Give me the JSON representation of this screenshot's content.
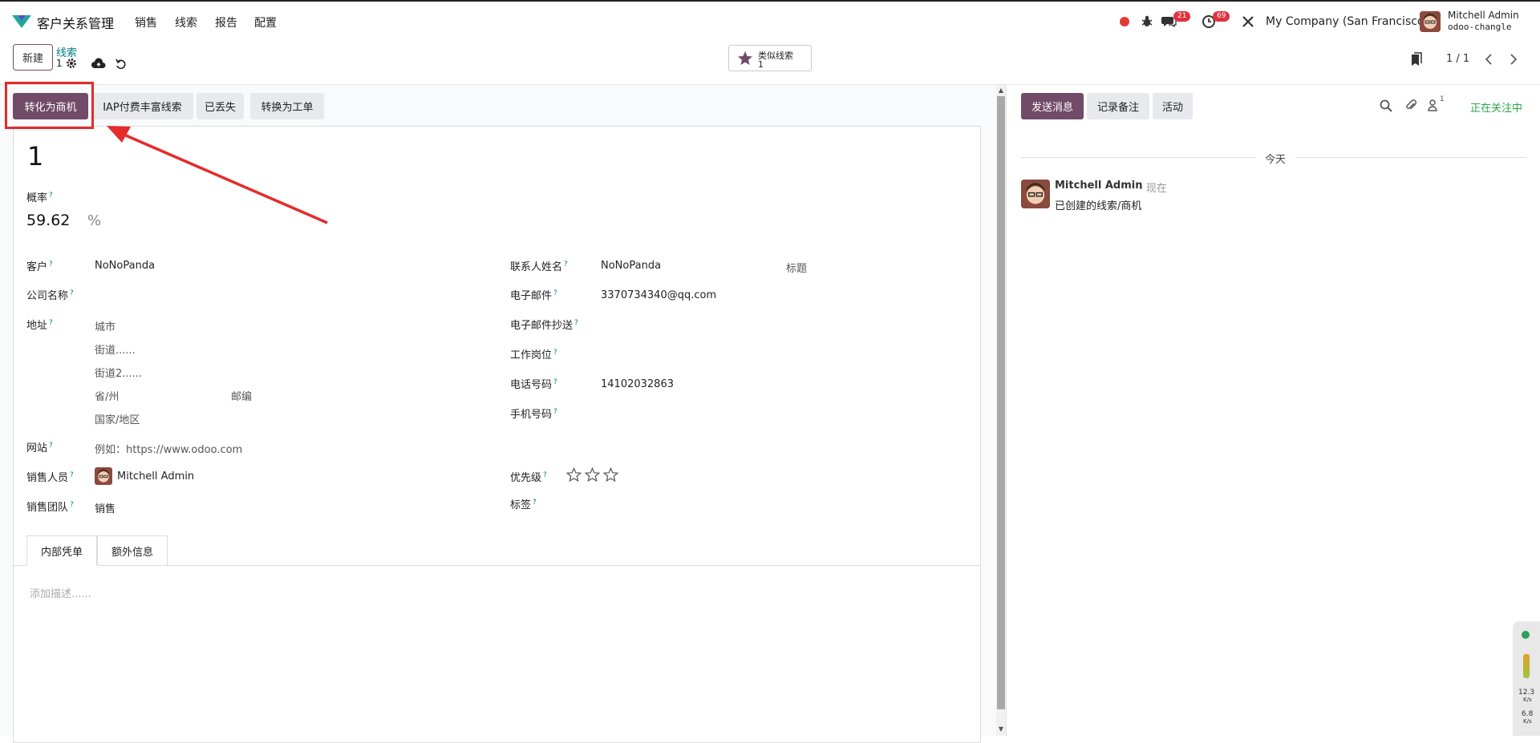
{
  "navbar": {
    "app_title": "客户关系管理",
    "menu": [
      "销售",
      "线索",
      "报告",
      "配置"
    ],
    "messages_badge": "21",
    "activities_badge": "69",
    "company": "My Company (San Francisco)",
    "user_name": "Mitchell Admin",
    "db_name": "odoo-changle"
  },
  "control_panel": {
    "new_label": "新建",
    "breadcrumb_link": "线索",
    "breadcrumb_record": "1",
    "smart_button_label": "类似线索",
    "smart_button_count": "1",
    "pager_value": "1 / 1"
  },
  "status_buttons": [
    "转化为商机",
    "IAP付费丰富线索",
    "已丢失",
    "转换为工单"
  ],
  "form": {
    "record_name": "1",
    "probability_label": "概率",
    "probability_value": "59.62",
    "probability_unit": "%",
    "customer_label": "客户",
    "customer_value": "NoNoPanda",
    "company_label": "公司名称",
    "address_label": "地址",
    "address_city": "城市",
    "address_street": "街道......",
    "address_street2": "街道2......",
    "address_state": "省/州",
    "address_zip": "邮编",
    "address_country": "国家/地区",
    "website_label": "网站",
    "website_placeholder": "例如：https://www.odoo.com",
    "salesperson_label": "销售人员",
    "salesperson_value": "Mitchell Admin",
    "sales_team_label": "销售团队",
    "sales_team_value": "销售",
    "contact_name_label": "联系人姓名",
    "contact_name_value": "NoNoPanda",
    "title_placeholder": "标题",
    "email_label": "电子邮件",
    "email_value": "3370734340@qq.com",
    "email_cc_label": "电子邮件抄送",
    "job_position_label": "工作岗位",
    "phone_label": "电话号码",
    "phone_value": "14102032863",
    "mobile_label": "手机号码",
    "priority_label": "优先级",
    "priority_stars": 0,
    "tags_label": "标签",
    "help_mark": "?"
  },
  "tabs": {
    "internal_notes": "内部凭单",
    "extra_info": "额外信息",
    "description_placeholder": "添加描述......"
  },
  "chatter": {
    "send_message": "发送消息",
    "log_note": "记录备注",
    "activity": "活动",
    "followers_count": "1",
    "following": "正在关注中",
    "today": "今天",
    "message_author": "Mitchell Admin",
    "message_time": "- 现在",
    "message_body": "已创建的线索/商机"
  },
  "network_widget": {
    "upload": "12.3",
    "download": "6.8",
    "unit": "K/s"
  },
  "colors": {
    "primary": "#714B67",
    "link": "#017e84",
    "annotation": "#e52b2b",
    "following": "#28a745",
    "badge": "#e0323d"
  }
}
